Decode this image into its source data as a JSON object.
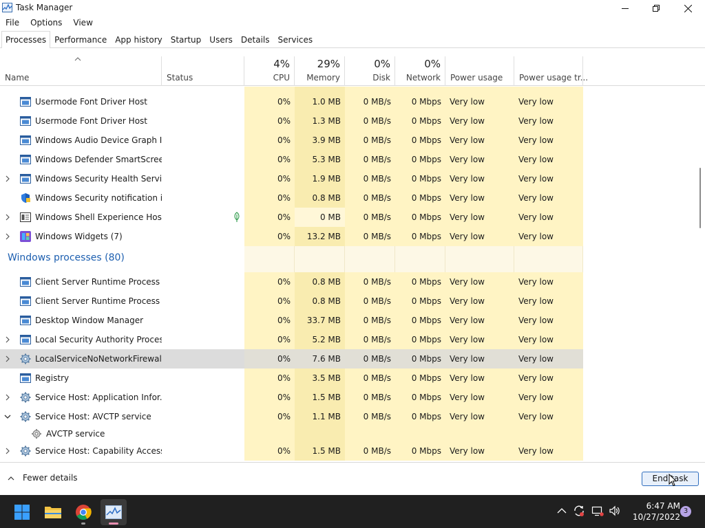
{
  "window": {
    "title": "Task Manager"
  },
  "menu": [
    "File",
    "Options",
    "View"
  ],
  "tabs": [
    "Processes",
    "Performance",
    "App history",
    "Startup",
    "Users",
    "Details",
    "Services"
  ],
  "active_tab": "Processes",
  "columns": {
    "name": "Name",
    "status": "Status",
    "cpu": {
      "pct": "4%",
      "label": "CPU"
    },
    "memory": {
      "pct": "29%",
      "label": "Memory"
    },
    "disk": {
      "pct": "0%",
      "label": "Disk"
    },
    "network": {
      "pct": "0%",
      "label": "Network"
    },
    "power": "Power usage",
    "power_trend": "Power usage tr..."
  },
  "rows_top": [
    {
      "name": "Usermode Font Driver Host",
      "cpu": "0%",
      "mem": "1.0 MB",
      "disk": "0 MB/s",
      "net": "0 Mbps",
      "power": "Very low",
      "trend": "Very low",
      "icon": "window-app-icon",
      "expand": false
    },
    {
      "name": "Usermode Font Driver Host",
      "cpu": "0%",
      "mem": "1.3 MB",
      "disk": "0 MB/s",
      "net": "0 Mbps",
      "power": "Very low",
      "trend": "Very low",
      "icon": "window-app-icon",
      "expand": false
    },
    {
      "name": "Windows Audio Device Graph Is...",
      "cpu": "0%",
      "mem": "3.9 MB",
      "disk": "0 MB/s",
      "net": "0 Mbps",
      "power": "Very low",
      "trend": "Very low",
      "icon": "window-app-icon",
      "expand": false
    },
    {
      "name": "Windows Defender SmartScreen",
      "cpu": "0%",
      "mem": "5.3 MB",
      "disk": "0 MB/s",
      "net": "0 Mbps",
      "power": "Very low",
      "trend": "Very low",
      "icon": "window-app-icon",
      "expand": false
    },
    {
      "name": "Windows Security Health Service",
      "cpu": "0%",
      "mem": "1.9 MB",
      "disk": "0 MB/s",
      "net": "0 Mbps",
      "power": "Very low",
      "trend": "Very low",
      "icon": "window-app-icon",
      "expand": true
    },
    {
      "name": "Windows Security notification i...",
      "cpu": "0%",
      "mem": "0.8 MB",
      "disk": "0 MB/s",
      "net": "0 Mbps",
      "power": "Very low",
      "trend": "Very low",
      "icon": "security-shield-icon",
      "expand": false
    },
    {
      "name": "Windows Shell Experience Host",
      "cpu": "0%",
      "mem": "0 MB",
      "disk": "0 MB/s",
      "net": "0 Mbps",
      "power": "Very low",
      "trend": "Very low",
      "icon": "shell-host-icon",
      "expand": true,
      "status_icon": "leaf-icon"
    },
    {
      "name": "Windows Widgets (7)",
      "cpu": "0%",
      "mem": "13.2 MB",
      "disk": "0 MB/s",
      "net": "0 Mbps",
      "power": "Very low",
      "trend": "Very low",
      "icon": "widgets-icon",
      "expand": true
    }
  ],
  "group": {
    "title": "Windows processes (80)"
  },
  "rows_windows": [
    {
      "name": "Client Server Runtime Process",
      "cpu": "0%",
      "mem": "0.8 MB",
      "disk": "0 MB/s",
      "net": "0 Mbps",
      "power": "Very low",
      "trend": "Very low",
      "icon": "window-app-icon",
      "expand": false
    },
    {
      "name": "Client Server Runtime Process",
      "cpu": "0%",
      "mem": "0.8 MB",
      "disk": "0 MB/s",
      "net": "0 Mbps",
      "power": "Very low",
      "trend": "Very low",
      "icon": "window-app-icon",
      "expand": false
    },
    {
      "name": "Desktop Window Manager",
      "cpu": "0%",
      "mem": "33.7 MB",
      "disk": "0 MB/s",
      "net": "0 Mbps",
      "power": "Very low",
      "trend": "Very low",
      "icon": "window-app-icon",
      "expand": false
    },
    {
      "name": "Local Security Authority Process...",
      "cpu": "0%",
      "mem": "5.2 MB",
      "disk": "0 MB/s",
      "net": "0 Mbps",
      "power": "Very low",
      "trend": "Very low",
      "icon": "window-app-icon",
      "expand": true
    },
    {
      "name": "LocalServiceNoNetworkFirewall ...",
      "cpu": "0%",
      "mem": "7.6 MB",
      "disk": "0 MB/s",
      "net": "0 Mbps",
      "power": "Very low",
      "trend": "Very low",
      "icon": "gear-service-icon",
      "expand": true,
      "selected": true
    },
    {
      "name": "Registry",
      "cpu": "0%",
      "mem": "3.5 MB",
      "disk": "0 MB/s",
      "net": "0 Mbps",
      "power": "Very low",
      "trend": "Very low",
      "icon": "window-app-icon",
      "expand": false
    },
    {
      "name": "Service Host: Application Infor...",
      "cpu": "0%",
      "mem": "1.5 MB",
      "disk": "0 MB/s",
      "net": "0 Mbps",
      "power": "Very low",
      "trend": "Very low",
      "icon": "gear-service-icon",
      "expand": true
    },
    {
      "name": "Service Host: AVCTP service",
      "cpu": "0%",
      "mem": "1.1 MB",
      "disk": "0 MB/s",
      "net": "0 Mbps",
      "power": "Very low",
      "trend": "Very low",
      "icon": "gear-service-icon",
      "expand": true,
      "expanded": true
    }
  ],
  "child_row": {
    "name": "AVCTP service",
    "icon": "gear-small-icon"
  },
  "last_row": {
    "name": "Service Host: Capability Access ...",
    "cpu": "0%",
    "mem": "1.5 MB",
    "disk": "0 MB/s",
    "net": "0 Mbps",
    "power": "Very low",
    "trend": "Very low",
    "icon": "gear-service-icon",
    "expand": true
  },
  "footer": {
    "fewer_details": "Fewer details",
    "end_task": "End task"
  },
  "taskbar": {
    "time": "6:47 AM",
    "date": "10/27/2022",
    "notifications": "3"
  },
  "colors": {
    "accent": "#1d5fb0",
    "cpu_bg": "#fff4c4",
    "memory_bg": "#f9ecb0",
    "taskbar_bg": "#202020"
  }
}
